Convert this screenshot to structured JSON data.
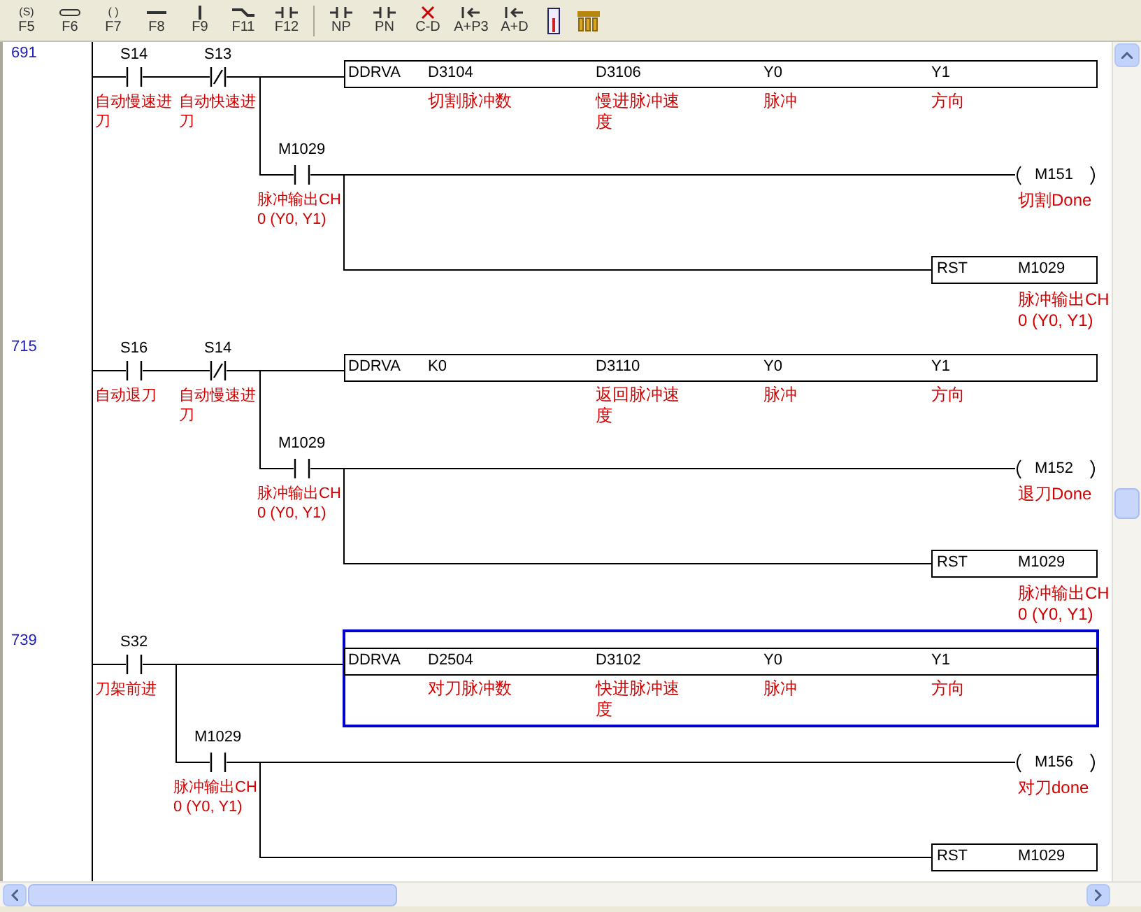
{
  "toolbar": [
    {
      "label": "F5",
      "symbol": "(S)",
      "kind": "symbol"
    },
    {
      "label": "F6",
      "kind": "oval"
    },
    {
      "label": "F7",
      "symbol": "( )",
      "kind": "symbol"
    },
    {
      "label": "F8",
      "kind": "hline"
    },
    {
      "label": "F9",
      "kind": "vline"
    },
    {
      "label": "F11",
      "kind": "bend"
    },
    {
      "label": "F12",
      "kind": "contact"
    },
    {
      "label": "NP",
      "kind": "contact"
    },
    {
      "label": "PN",
      "kind": "contact"
    },
    {
      "label": "C-D",
      "kind": "cross"
    },
    {
      "label": "A+P3",
      "kind": "arrow"
    },
    {
      "label": "A+D",
      "kind": "arrow"
    },
    {
      "kind": "meter"
    },
    {
      "kind": "blocks"
    }
  ],
  "rungs": [
    {
      "step": "691",
      "selected": false,
      "contacts": [
        {
          "label": "S14",
          "kind": "open",
          "comment": "自动慢速进刀"
        },
        {
          "label": "S13",
          "kind": "closed",
          "comment": "自动快速进刀"
        }
      ],
      "branch_contact": {
        "label": "M1029",
        "kind": "open",
        "comment": "脉冲输出CH 0 (Y0, Y1)"
      },
      "instruction": [
        {
          "text": "DDRVA"
        },
        {
          "text": "D3104",
          "comment": "切割脉冲数"
        },
        {
          "text": "D3106",
          "comment": "慢进脉冲速度"
        },
        {
          "text": "Y0",
          "comment": "脉冲"
        },
        {
          "text": "Y1",
          "comment": "方向"
        }
      ],
      "coil": {
        "label": "M151",
        "comment": "切割Done"
      },
      "reset": {
        "op": "RST",
        "operand": "M1029",
        "comment": "脉冲输出CH 0 (Y0, Y1)"
      }
    },
    {
      "step": "715",
      "selected": false,
      "contacts": [
        {
          "label": "S16",
          "kind": "open",
          "comment": "自动退刀"
        },
        {
          "label": "S14",
          "kind": "closed",
          "comment": "自动慢速进刀"
        }
      ],
      "branch_contact": {
        "label": "M1029",
        "kind": "open",
        "comment": "脉冲输出CH 0 (Y0, Y1)"
      },
      "instruction": [
        {
          "text": "DDRVA"
        },
        {
          "text": "K0"
        },
        {
          "text": "D3110",
          "comment": "返回脉冲速度"
        },
        {
          "text": "Y0",
          "comment": "脉冲"
        },
        {
          "text": "Y1",
          "comment": "方向"
        }
      ],
      "coil": {
        "label": "M152",
        "comment": "退刀Done"
      },
      "reset": {
        "op": "RST",
        "operand": "M1029",
        "comment": "脉冲输出CH 0 (Y0, Y1)"
      }
    },
    {
      "step": "739",
      "selected": true,
      "contacts": [
        {
          "label": "S32",
          "kind": "open",
          "comment": "刀架前进"
        }
      ],
      "branch_contact": {
        "label": "M1029",
        "kind": "open",
        "comment": "脉冲输出CH 0 (Y0, Y1)"
      },
      "instruction": [
        {
          "text": "DDRVA"
        },
        {
          "text": "D2504",
          "comment": "对刀脉冲数"
        },
        {
          "text": "D3102",
          "comment": "快进脉冲速度"
        },
        {
          "text": "Y0",
          "comment": "脉冲"
        },
        {
          "text": "Y1",
          "comment": "方向"
        }
      ],
      "coil": {
        "label": "M156",
        "comment": "对刀done"
      },
      "reset": {
        "op": "RST",
        "operand": "M1029"
      }
    }
  ]
}
